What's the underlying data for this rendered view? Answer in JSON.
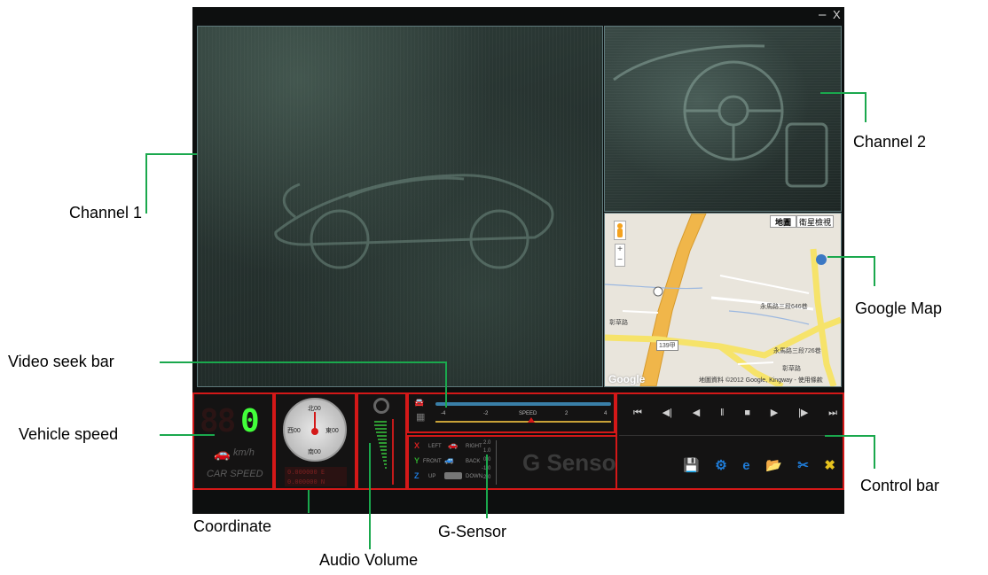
{
  "window": {
    "minimize_label": "–",
    "close_label": "X"
  },
  "map": {
    "tab_map": "地圖",
    "tab_satellite": "衛星檢視",
    "zoom_plus": "+",
    "zoom_minus": "−",
    "logo": "Google",
    "attribution": "地圖資料 ©2012 Google, Kingway - 使用條款",
    "road_labels": [
      "彰草路",
      "永馬路三段646巷",
      "139甲",
      "永馬路三段726巷",
      "彰草路"
    ]
  },
  "speed": {
    "digits_dim": "88",
    "digit_lit": "0",
    "unit": "km/h",
    "caption": "CAR SPEED"
  },
  "coordinate": {
    "north": "北00",
    "south": "南00",
    "west": "西00",
    "east": "東00",
    "line1": "0.000000 E",
    "line2": "0.000000 N"
  },
  "seek": {
    "ticks": [
      "-4",
      "-2",
      "SPEED",
      "2",
      "4"
    ]
  },
  "gsensor": {
    "title": "G Sensor",
    "rows": [
      {
        "axis": "X",
        "left": "LEFT",
        "right": "RIGHT"
      },
      {
        "axis": "Y",
        "left": "FRONT",
        "right": "BACK"
      },
      {
        "axis": "Z",
        "left": "UP",
        "right": "DOWN"
      }
    ],
    "scale": [
      "2.0",
      "1.0",
      "0.0",
      "-1.0",
      "-2.0"
    ],
    "colors": {
      "x": "#d42020",
      "y": "#2ea82e",
      "z": "#1e78d8"
    }
  },
  "controls": {
    "playback": [
      "⏮",
      "◀|",
      "◀",
      "‖",
      "■",
      "▶",
      "|▶",
      "⏭"
    ],
    "tools": [
      "💾",
      "⚙",
      "e",
      "📂",
      "✂",
      "✖"
    ]
  },
  "callouts": {
    "channel1": "Channel 1",
    "channel2": "Channel 2",
    "google_map": "Google Map",
    "video_seek_bar": "Video seek bar",
    "vehicle_speed": "Vehicle speed",
    "control_bar": "Control bar",
    "coordinate": "Coordinate",
    "g_sensor": "G-Sensor",
    "audio_volume": "Audio Volume"
  },
  "colors": {
    "annotation_line": "#1aa84d",
    "highlight_box": "#d41818",
    "lcd_green": "#42ff3a"
  }
}
